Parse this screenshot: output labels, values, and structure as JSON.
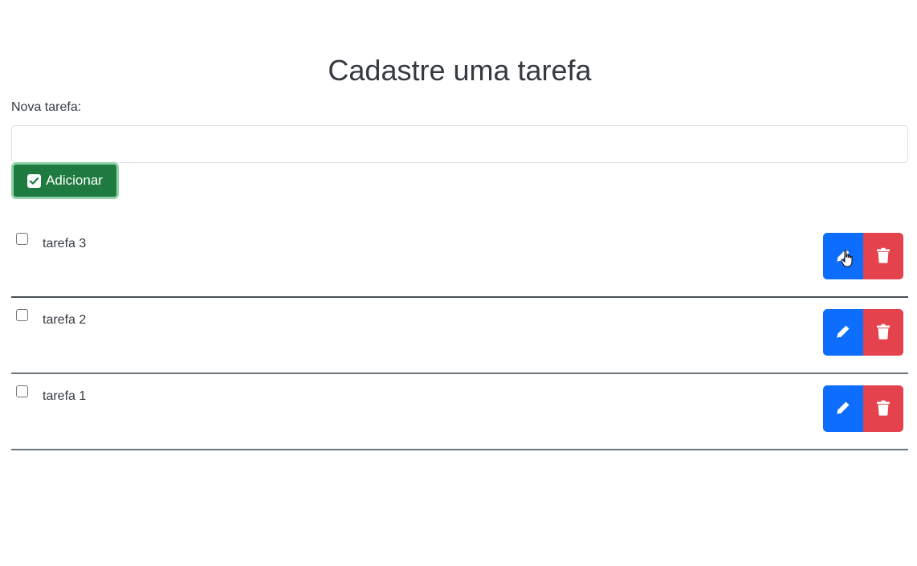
{
  "header": {
    "title": "Cadastre uma tarefa"
  },
  "form": {
    "label": "Nova tarefa:",
    "input_value": "",
    "input_placeholder": "",
    "add_button_label": "Adicionar",
    "add_button_icon": "check-square-icon"
  },
  "tasks": [
    {
      "label": "tarefa 3",
      "checked": false,
      "edit_icon": "pencil-icon",
      "delete_icon": "trash-icon"
    },
    {
      "label": "tarefa 2",
      "checked": false,
      "edit_icon": "pencil-icon",
      "delete_icon": "trash-icon"
    },
    {
      "label": "tarefa 1",
      "checked": false,
      "edit_icon": "pencil-icon",
      "delete_icon": "trash-icon"
    }
  ],
  "colors": {
    "add_button": "#1e7a3f",
    "edit_button": "#0d6efd",
    "delete_button": "#e4434e",
    "divider": "#495057"
  }
}
